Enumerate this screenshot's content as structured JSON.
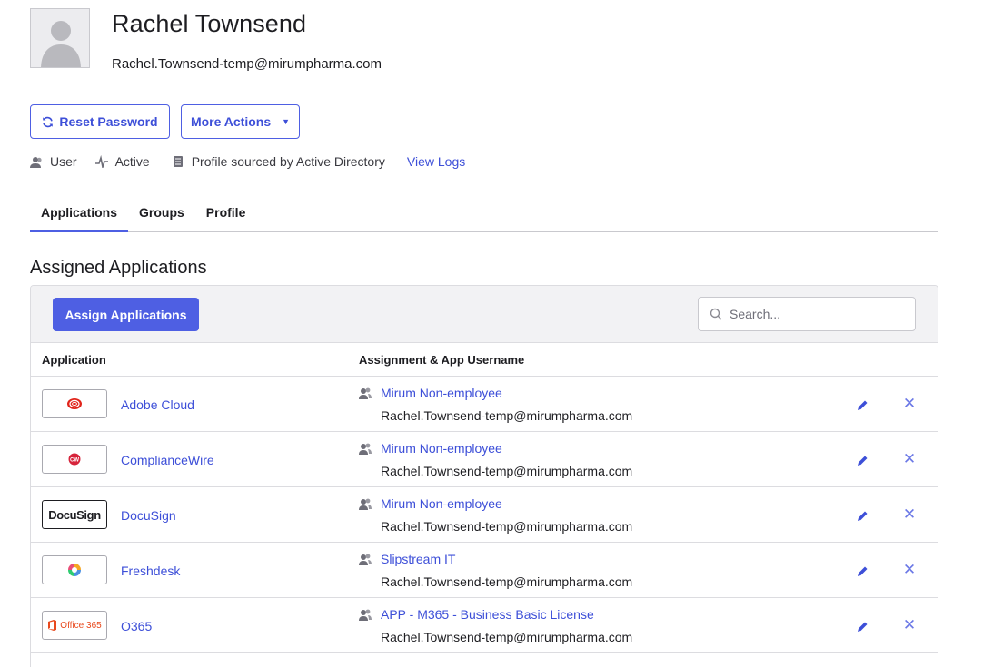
{
  "user": {
    "name": "Rachel Townsend",
    "email": "Rachel.Townsend-temp@mirumpharma.com"
  },
  "actions": {
    "reset_password": "Reset Password",
    "more_actions": "More Actions"
  },
  "meta": {
    "role": "User",
    "status": "Active",
    "source": "Profile sourced by Active Directory",
    "view_logs": "View Logs"
  },
  "tabs": [
    {
      "label": "Applications",
      "active": true
    },
    {
      "label": "Groups",
      "active": false
    },
    {
      "label": "Profile",
      "active": false
    }
  ],
  "section_title": "Assigned Applications",
  "toolbar": {
    "assign_button": "Assign Applications",
    "search_placeholder": "Search..."
  },
  "table": {
    "headers": [
      "Application",
      "Assignment & App Username"
    ],
    "rows": [
      {
        "app": "Adobe Cloud",
        "logo": "adobe-cloud-logo",
        "group": "Mirum Non-employee",
        "username": "Rachel.Townsend-temp@mirumpharma.com"
      },
      {
        "app": "ComplianceWire",
        "logo": "compliancewire-logo",
        "group": "Mirum Non-employee",
        "username": "Rachel.Townsend-temp@mirumpharma.com"
      },
      {
        "app": "DocuSign",
        "logo": "docusign-logo",
        "logo_text": "DocuSign",
        "group": "Mirum Non-employee",
        "username": "Rachel.Townsend-temp@mirumpharma.com"
      },
      {
        "app": "Freshdesk",
        "logo": "freshdesk-logo",
        "group": "Slipstream IT",
        "username": "Rachel.Townsend-temp@mirumpharma.com"
      },
      {
        "app": "O365",
        "logo": "office365-logo",
        "logo_text": "Office 365",
        "group": "APP - M365 - Business Basic License",
        "username": "Rachel.Townsend-temp@mirumpharma.com"
      }
    ]
  },
  "colors": {
    "accent": "#4e5fe3",
    "link": "#3d4fd8",
    "toolbar_bg": "#f2f2f4"
  }
}
